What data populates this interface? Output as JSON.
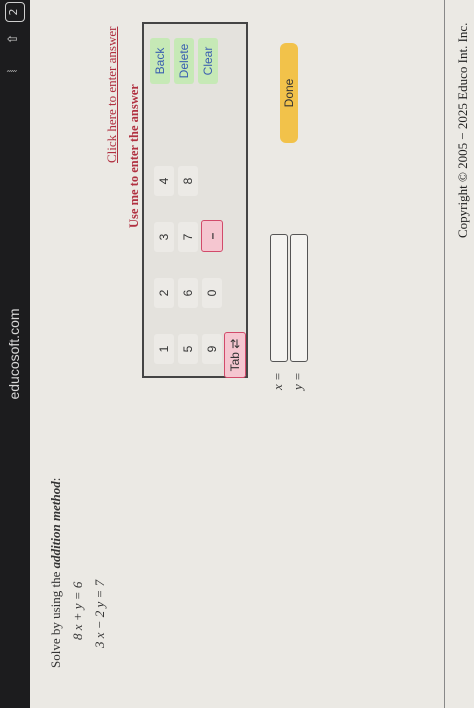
{
  "browser": {
    "url": "educosoft.com",
    "tab_count": "2"
  },
  "problem": {
    "instruction_prefix": "Solve by using the",
    "instruction_method": "addition method",
    "instruction_suffix": ":",
    "equation1": "8 x + y = 6",
    "equation2": "3 x − 2 y = 7"
  },
  "keypad": {
    "title": "Use me to enter the answer",
    "keys_row1": [
      "1",
      "2",
      "3",
      "4"
    ],
    "keys_row2": [
      "5",
      "6",
      "7",
      "8"
    ],
    "keys_row3": [
      "9",
      "0",
      "–"
    ],
    "tab_label": "Tab ⇄",
    "back_label": "Back",
    "delete_label": "Delete",
    "clear_label": "Clear"
  },
  "link": {
    "text": "Click here to enter answer"
  },
  "answers": {
    "x_label": "x =",
    "y_label": "y =",
    "x_value": "",
    "y_value": ""
  },
  "done_label": "Done",
  "copyright": "Copyright © 2005 − 2025 Educo Int. Inc."
}
